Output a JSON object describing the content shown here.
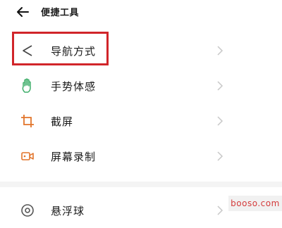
{
  "header": {
    "back_icon": "arrow-left-icon",
    "title": "便捷工具"
  },
  "items": [
    {
      "label": "导航方式",
      "icon": "navigation-triangle-icon",
      "highlighted": true
    },
    {
      "label": "手势体感",
      "icon": "hand-gesture-icon"
    },
    {
      "label": "截屏",
      "icon": "crop-icon"
    },
    {
      "label": "屏幕录制",
      "icon": "screen-record-icon"
    },
    {
      "label": "悬浮球",
      "icon": "floating-ball-icon"
    }
  ],
  "colors": {
    "accent_icon": "#3fae6a",
    "orange_icon": "#e2742a",
    "highlight_border": "#d1252a"
  },
  "watermark": "booso.com"
}
